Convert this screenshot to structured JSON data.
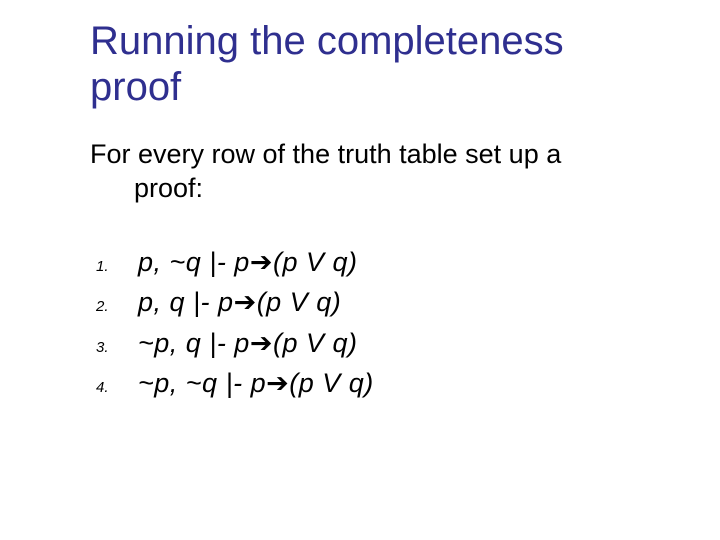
{
  "title_line1": "Running the completeness",
  "title_line2": "proof",
  "intro_line1": "For every row of the truth table set up a",
  "intro_line2": "proof:",
  "items": [
    {
      "num": "1.",
      "prefix": "p, ~q |- p",
      "arrow": "➔",
      "suffix": "(p V q)"
    },
    {
      "num": "2.",
      "prefix": "p, q |- p",
      "arrow": "➔",
      "suffix": "(p V q)"
    },
    {
      "num": "3.",
      "prefix": "~p, q |- p",
      "arrow": "➔",
      "suffix": "(p V q)"
    },
    {
      "num": "4.",
      "prefix": "~p, ~q |- p",
      "arrow": "➔",
      "suffix": "(p V q)"
    }
  ]
}
